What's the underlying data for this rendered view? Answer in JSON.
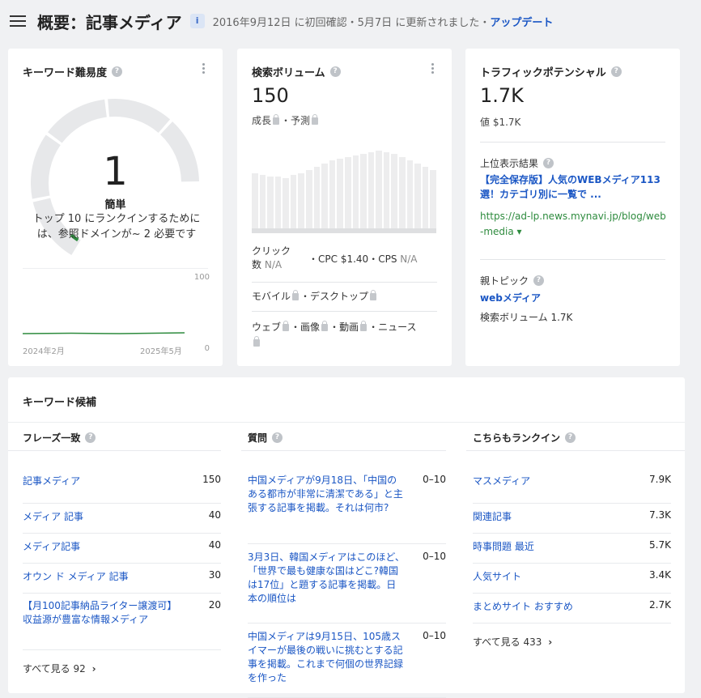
{
  "header": {
    "title": "概要：記事メディア",
    "badge": "i",
    "meta": "2016年9月12日 に初回確認・5月7日 に更新されました・",
    "update_link": "アップデート"
  },
  "kd": {
    "title": "キーワード難易度",
    "value": "1",
    "level": "簡単",
    "desc": "トップ 10 にランクインするために は、参照ドメインが~ 2 必要です",
    "axis_max": "100",
    "axis_min": "0",
    "x_start": "2024年2月",
    "x_end": "2025年5月",
    "score_fraction": 0.01
  },
  "volume": {
    "title": "検索ボリューム",
    "value": "150",
    "growth": "成長",
    "forecast": "予測",
    "clicks_label": "クリック 数",
    "clicks_value": "N/A",
    "cpc": "CPC $1.40",
    "cps_label": "CPS",
    "cps_value": "N/A",
    "mobile": "モバイル",
    "desktop": "デスクトップ",
    "web": "ウェブ",
    "image": "画像",
    "video": "動画",
    "news": "ニュース"
  },
  "traffic": {
    "title": "トラフィックポテンシャル",
    "value": "1.7K",
    "worth": "値 $1.7K",
    "top_result_label": "上位表示結果",
    "top_result_title": "【完全保存版】人気のWEBメディア113選！カテゴリ別に一覧で ...",
    "top_result_url": "https://ad-lp.news.mynavi.jp/blog/web-media",
    "parent_label": "親トピック",
    "parent_topic": "webメディア",
    "parent_volume": "検索ボリューム 1.7K"
  },
  "ideas": {
    "title": "キーワード候補",
    "phrase": {
      "title": "フレーズ一致",
      "items": [
        {
          "kw": "記事メディア",
          "vol": "150"
        },
        {
          "kw": "メディア 記事",
          "vol": "40"
        },
        {
          "kw": "メディア記事",
          "vol": "40"
        },
        {
          "kw": "オウン ド メディア 記事",
          "vol": "30"
        },
        {
          "kw": "【月100記事納品ライター譲渡可】収益源が豊富な情報メディア",
          "vol": "20"
        }
      ],
      "see_all": "すべて見る 92"
    },
    "questions": {
      "title": "質問",
      "items": [
        {
          "kw": "中国メディアが9月18日、「中国のある都市が非常に清潔である」と主張する記事を掲載。それは何市?",
          "vol": "0–10"
        },
        {
          "kw": "3月3日、韓国メディアはこのほど、「世界で最も健康な国はどこ?韓国は17位」と題する記事を掲載。日本の順位は",
          "vol": "0–10"
        },
        {
          "kw": "中国メディアは9月15日、105歳スイマーが最後の戦いに挑むとする記事を掲載。これまで何個の世界記録を作った",
          "vol": "0–10"
        }
      ]
    },
    "also_rank": {
      "title": "こちらもランクイン",
      "items": [
        {
          "kw": "マスメディア",
          "vol": "7.9K"
        },
        {
          "kw": "関連記事",
          "vol": "7.3K"
        },
        {
          "kw": "時事問題 最近",
          "vol": "5.7K"
        },
        {
          "kw": "人気サイト",
          "vol": "3.4K"
        },
        {
          "kw": "まとめサイト おすすめ",
          "vol": "2.7K"
        }
      ],
      "see_all": "すべて見る 433"
    }
  },
  "colors": {
    "link": "#1a56c4",
    "green": "#2e8b3e",
    "gauge": "#e7e8ea"
  }
}
